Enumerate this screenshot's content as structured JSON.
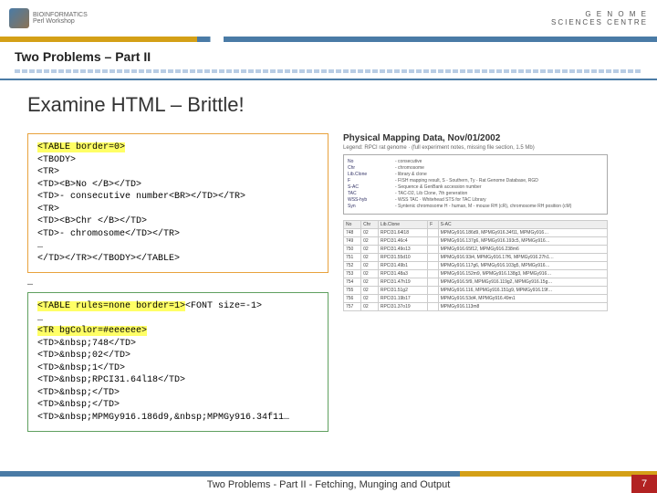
{
  "header": {
    "logo_left_top": "BIOINFORMATICS",
    "logo_left_bottom": "Perl Workshop",
    "logo_right_top": "G E N O M E",
    "logo_right_bottom": "SCIENCES CENTRE",
    "breadcrumb": "Two Problems – Part II"
  },
  "title": "Examine HTML – Brittle!",
  "code1": {
    "highlight": "<TABLE border=0>",
    "lines": [
      "<TBODY>",
      "<TR>",
      "<TD><B>No </B></TD>",
      "<TD>- consecutive number<BR></TD></TR>",
      "<TR>",
      "<TD><B>Chr </B></TD>",
      "<TD>- chromosome</TD></TR>",
      "…",
      "</TD></TR></TBODY></TABLE>"
    ]
  },
  "ellipsis": "…",
  "code2": {
    "highlight_open": "<TABLE rules=none border=1>",
    "highlight_tail": "<FONT size=-1>",
    "lines_pre": [
      "…"
    ],
    "row_highlight": "<TR bgColor=#eeeeee>",
    "lines": [
      "<TD>&nbsp;748</TD>",
      "<TD>&nbsp;02</TD>",
      "<TD>&nbsp;1</TD>",
      "<TD>&nbsp;RPCI31.64l18</TD>",
      "<TD>&nbsp;</TD>",
      "<TD>&nbsp;</TD>",
      "<TD>&nbsp;MPMGy916.186d9,&nbsp;MPMGy916.34f11…"
    ]
  },
  "preview": {
    "title": "Physical Mapping Data, Nov/01/2002",
    "subtitle": "Legend: RPCI rat genome · (full experiment notes, missing file section, 1.5 Mb)",
    "legend_rows": [
      [
        "No",
        "- consecutive"
      ],
      [
        "Chr",
        "- chromosome"
      ],
      [
        "Lib.Clone",
        "- library & clone"
      ],
      [
        "F",
        "- FISH mapping result, S - Southern, Ty - Rat Genome Database, RGD"
      ],
      [
        "S-AC",
        "- Sequence & GenBank accession number"
      ],
      [
        "TAC",
        "- TAC-D2, Lib Clone, 7th generation"
      ],
      [
        "WSS-hyb",
        "- WSS TAC · Whitehead STS for TAC Library"
      ],
      [
        "Syn",
        "- Syntenic chromosome H - human, M - mouse RH (cR), chromosome RH position (cM)"
      ]
    ],
    "columns": [
      "No",
      "Chr",
      "Lib.Clone",
      "F",
      "S-AC"
    ],
    "rows": [
      [
        "748",
        "02",
        "RPCI31.64l18",
        "",
        "MPMGy916.186d9, MPMGy916.34f11, MPMGy916…"
      ],
      [
        "749",
        "02",
        "RPCI31.46c4",
        "",
        "MPMGy916.137g6, MPMGy916.193c5, MPMGy916…"
      ],
      [
        "750",
        "02",
        "RPCI31.49o13",
        "",
        "MPMGy916.65f12, MPMGy916.238m6"
      ],
      [
        "751",
        "02",
        "RPCI31.55d10",
        "",
        "MPMGy916.93i4, MPMGy916.17f6, MPMGy916.27h1…"
      ],
      [
        "752",
        "02",
        "RPCI31.49b1",
        "",
        "MPMGy916.117g6, MPMGy916.103g5, MPMGy916…"
      ],
      [
        "753",
        "02",
        "RPCI31.48a3",
        "",
        "MPMGy916.152m9, MPMGy916.138g3, MPMGy916…"
      ],
      [
        "754",
        "02",
        "RPCI31.47h19",
        "",
        "MPMGy916.5f9, MPMGy916.119g2, MPMGy916.15g…"
      ],
      [
        "755",
        "02",
        "RPCI31.51g2",
        "",
        "MPMGy916.116, MPMGy916.151g9, MPMGy916.19f…"
      ],
      [
        "756",
        "02",
        "RPCI31.19b17",
        "",
        "MPMGy916.53d4, MPMGy916.49m1"
      ],
      [
        "757",
        "02",
        "RPCI31.37o19",
        "",
        "MPMGy916.113m8"
      ]
    ]
  },
  "footer": {
    "text": "Two Problems - Part II - Fetching, Munging and Output",
    "page": "7"
  }
}
